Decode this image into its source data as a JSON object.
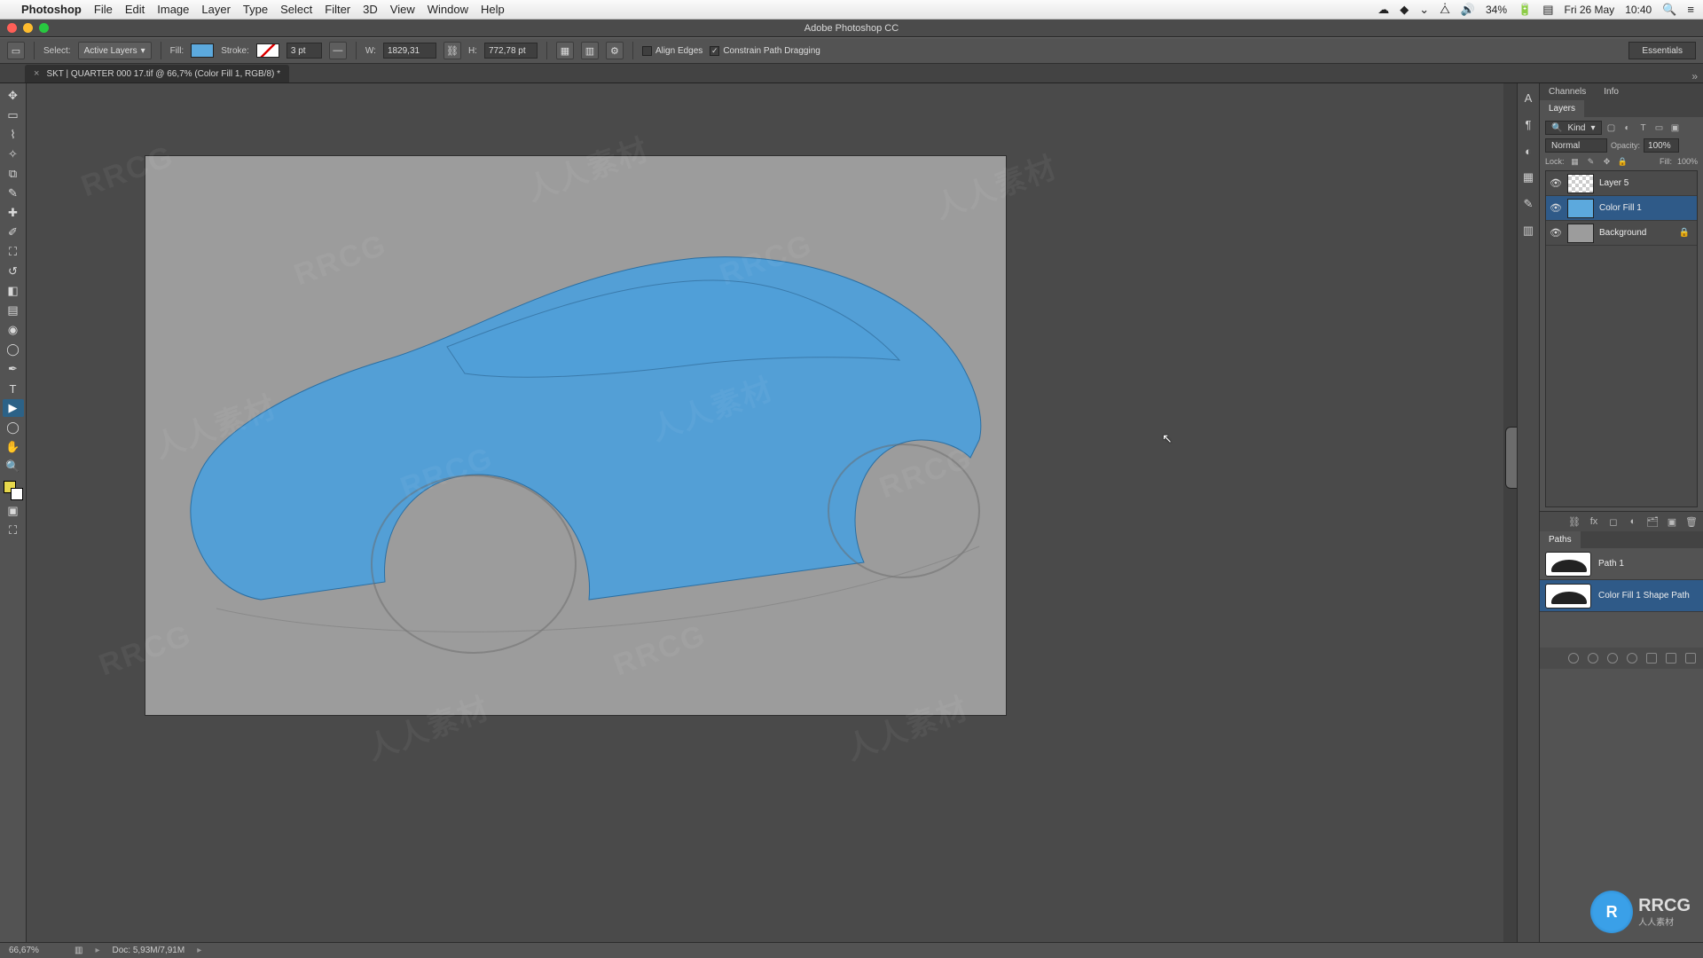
{
  "mac_menu": {
    "app": "Photoshop",
    "items": [
      "File",
      "Edit",
      "Image",
      "Layer",
      "Type",
      "Select",
      "Filter",
      "3D",
      "View",
      "Window",
      "Help"
    ],
    "battery": "34%",
    "date": "Fri 26 May",
    "time": "10:40"
  },
  "window_title": "Adobe Photoshop CC",
  "options": {
    "select_label": "Select:",
    "select_value": "Active Layers",
    "fill_label": "Fill:",
    "stroke_label": "Stroke:",
    "stroke_width": "3 pt",
    "w_label": "W:",
    "w_value": "1829,31",
    "h_label": "H:",
    "h_value": "772,78 pt",
    "align_edges": "Align Edges",
    "constrain": "Constrain Path Dragging",
    "workspace": "Essentials"
  },
  "doc_tab": "SKT | QUARTER 000 17.tif @ 66,7% (Color Fill 1, RGB/8) *",
  "panels": {
    "channels": "Channels",
    "info": "Info",
    "layers_tab": "Layers",
    "paths_tab": "Paths",
    "kind_label": "Kind",
    "blend_mode": "Normal",
    "opacity_label": "Opacity:",
    "opacity_value": "100%",
    "lock_label": "Lock:",
    "fill_label": "Fill:",
    "fill_value": "100%",
    "layers": [
      {
        "name": "Layer 5",
        "type": "checker"
      },
      {
        "name": "Color Fill 1",
        "type": "solid",
        "selected": true
      },
      {
        "name": "Background",
        "type": "bg",
        "locked": true
      }
    ],
    "paths": [
      {
        "name": "Path 1"
      },
      {
        "name": "Color Fill 1 Shape Path",
        "selected": true
      }
    ]
  },
  "status": {
    "zoom": "66,67%",
    "doc": "Doc: 5,93M/7,91M"
  },
  "logo": {
    "main": "RRCG",
    "sub": "人人素材"
  }
}
